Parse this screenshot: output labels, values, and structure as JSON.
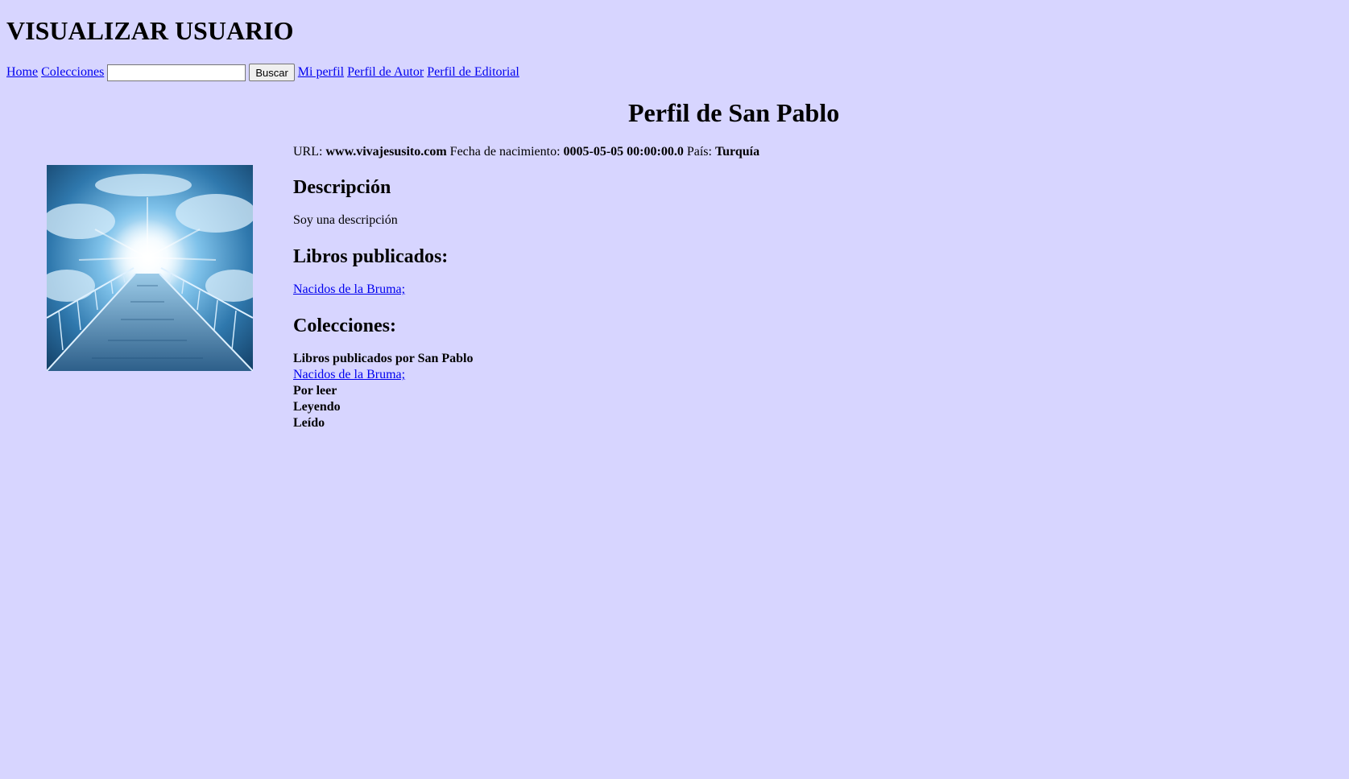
{
  "site": {
    "title": "VISUALIZAR USUARIO"
  },
  "nav": {
    "home": "Home",
    "colecciones": "Colecciones",
    "search_value": "",
    "search_button": "Buscar",
    "mi_perfil": "Mi perfil",
    "perfil_autor": "Perfil de Autor",
    "perfil_editorial": "Perfil de Editorial"
  },
  "profile": {
    "title": "Perfil de San Pablo",
    "url_label": "URL:",
    "url_value": "www.vivajesusito.com",
    "birth_label": "Fecha de nacimiento:",
    "birth_value": "0005-05-05 00:00:00.0",
    "country_label": "País:",
    "country_value": "Turquía",
    "avatar_icon": "sky-bridge-light-image"
  },
  "description": {
    "heading": "Descripción",
    "text": "Soy una descripción"
  },
  "books": {
    "heading": "Libros publicados:",
    "items": [
      "Nacidos de la Bruma;"
    ]
  },
  "collections": {
    "heading": "Colecciones:",
    "published_title": "Libros publicados por San Pablo",
    "published_items": [
      "Nacidos de la Bruma;"
    ],
    "por_leer": "Por leer",
    "leyendo": "Leyendo",
    "leido": "Leído"
  },
  "colors": {
    "background": "#d7d5ff",
    "link": "#0000ee"
  }
}
